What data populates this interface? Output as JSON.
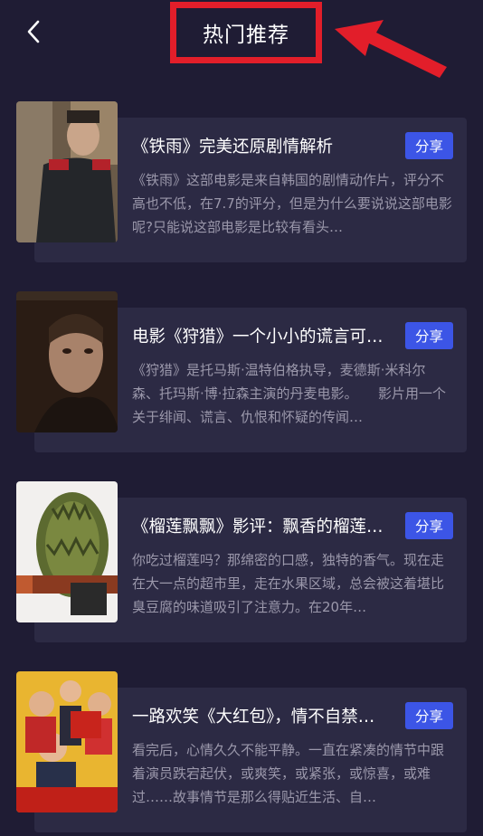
{
  "header": {
    "title": "热门推荐",
    "back_icon": "chevron-left-icon"
  },
  "colors": {
    "background": "#1f1c34",
    "card": "#2c2a44",
    "share_button": "#3c55e6",
    "annotation_red": "#e21e2a",
    "description": "#9b98ab"
  },
  "articles": [
    {
      "title": "《铁雨》完美还原剧情解析",
      "description": "《铁雨》这部电影是来自韩国的剧情动作片，评分不高也不低，在7.7的评分，但是为什么要说说这部电影呢?只能说这部电影是比较有看头…",
      "share_label": "分享"
    },
    {
      "title": "电影《狩猎》一个小小的谎言可…",
      "description": "《狩猎》是托马斯·温特伯格执导，麦德斯·米科尔森、托玛斯·博·拉森主演的丹麦电影。　　影片用一个关于绯闻、谎言、仇恨和怀疑的传闻…",
      "share_label": "分享"
    },
    {
      "title": "《榴莲飘飘》影评：飘香的榴莲…",
      "description": "你吃过榴莲吗？那绵密的口感，独特的香气。现在走在大一点的超市里，走在水果区域，总会被这着堪比臭豆腐的味道吸引了注意力。在20年…",
      "share_label": "分享"
    },
    {
      "title": "一路欢笑《大红包》，情不自禁…",
      "description": "看完后，心情久久不能平静。一直在紧凑的情节中跟着演员跌宕起伏，或爽笑，或紧张，或惊喜，或难过……故事情节是那么得贴近生活、自…",
      "share_label": "分享"
    }
  ]
}
